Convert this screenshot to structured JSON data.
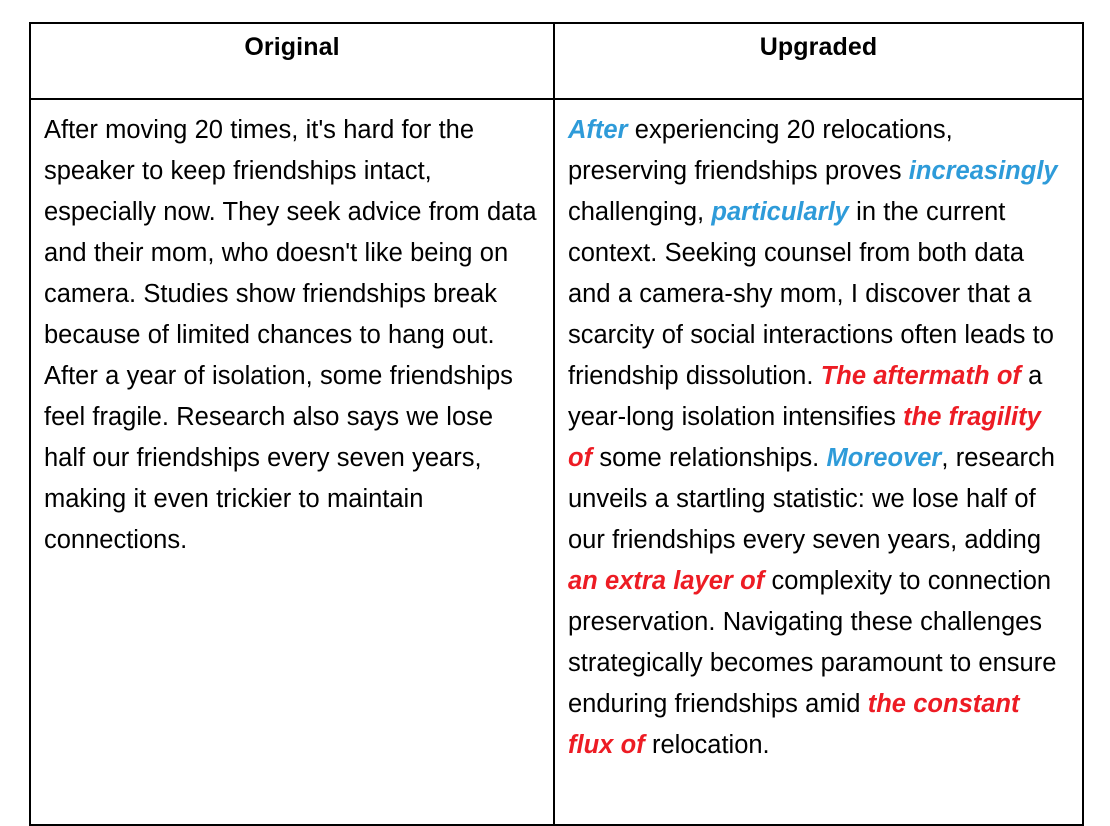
{
  "table": {
    "headers": {
      "left": "Original",
      "right": "Upgraded"
    },
    "colors": {
      "blue_emphasis": "#2E9BD9",
      "red_emphasis": "#ED1C24",
      "text": "#000000",
      "border": "#000000",
      "background": "#FFFFFF"
    },
    "rows": [
      {
        "original": {
          "full_text": "After moving 20 times, it's hard for the speaker to keep friendships intact, especially now. They seek advice from data and their mom, who doesn't like being on camera. Studies show friendships break because of limited chances to hang out. After a year of isolation, some friendships feel fragile. Research also says we lose half our friendships every seven years, making it even trickier to maintain connections.",
          "lines": [
            "After moving 20 times, it's hard for the",
            "speaker to keep friendships intact, especially",
            "now. They seek advice from data and their",
            "mom, who doesn't like being on camera.",
            "Studies show friendships break because of",
            "limited chances to hang out. After a year of",
            "isolation, some friendships feel fragile.",
            "Research also says we lose half our",
            "friendships every seven years, making it even",
            "trickier to maintain connections."
          ]
        },
        "upgraded": {
          "full_text": "After experiencing 20 relocations, preserving friendships proves increasingly challenging, particularly in the current context. Seeking counsel from both data and a camera-shy mom, I discover that a scarcity of social interactions often leads to friendship dissolution. The aftermath of a year-long isolation intensifies the fragility of some relationships. Moreover, research unveils a startling statistic: we lose half of our friendships every seven years, adding an extra layer of complexity to connection preservation. Navigating these challenges strategically becomes paramount to ensure enduring friendships amid the constant flux of relocation.",
          "segments": [
            {
              "text": "After",
              "style": "blue"
            },
            {
              "text": " experiencing 20 relocations, preserving friendships proves ",
              "style": "plain"
            },
            {
              "text": "increasingly",
              "style": "blue"
            },
            {
              "text": " challenging, ",
              "style": "plain"
            },
            {
              "text": "particularly",
              "style": "blue"
            },
            {
              "text": " in the current context. Seeking counsel from both data and a camera-shy mom, I discover that a scarcity of social interactions often leads to friendship dissolution. ",
              "style": "plain"
            },
            {
              "text": "The aftermath of",
              "style": "red"
            },
            {
              "text": " a year-long isolation intensifies ",
              "style": "plain"
            },
            {
              "text": "the fragility of",
              "style": "red"
            },
            {
              "text": " some relationships. ",
              "style": "plain"
            },
            {
              "text": "Moreover",
              "style": "blue"
            },
            {
              "text": ", research unveils a startling statistic: we lose half of our friendships every seven years, adding ",
              "style": "plain"
            },
            {
              "text": "an extra layer of",
              "style": "red"
            },
            {
              "text": " complexity to connection preservation. Navigating these challenges strategically becomes paramount to ensure enduring friendships amid ",
              "style": "plain"
            },
            {
              "text": "the constant flux of",
              "style": "red"
            },
            {
              "text": " relocation.",
              "style": "plain"
            }
          ],
          "lines": [
            "After experiencing 20 relocations,",
            "preserving friendships proves increasingly",
            "challenging, particularly in the current",
            "context. Seeking counsel from both data",
            "and a camera-shy mom, I discover that a",
            "scarcity of social interactions often leads",
            "to friendship dissolution. The aftermath",
            "of a year-long isolation intensifies the",
            "fragility of some relationships. Moreover,",
            "research unveils a startling statistic: we",
            "lose half of our friendships every seven",
            "years, adding an extra layer of complexity",
            "to connection preservation. Navigating",
            "these challenges strategically becomes",
            "paramount to ensure enduring",
            "friendships amid the constant flux of",
            "relocation."
          ]
        }
      }
    ]
  }
}
